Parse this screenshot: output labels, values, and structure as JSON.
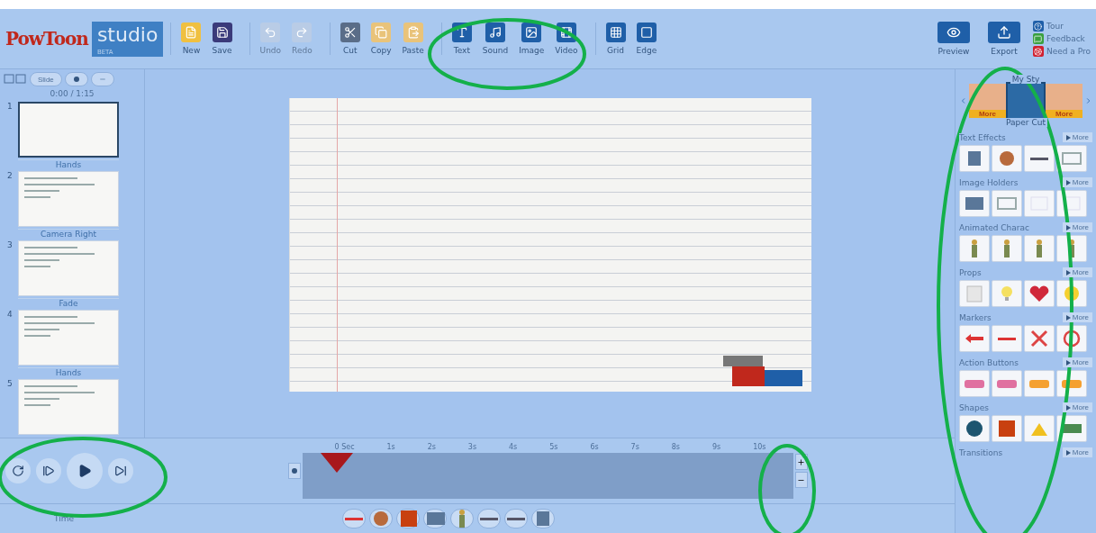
{
  "logo": {
    "brand": "PowToon",
    "product": "studio",
    "tag": "BETA"
  },
  "toolbar": {
    "groups": [
      [
        {
          "kind": "new",
          "label": "New",
          "disabled": false
        },
        {
          "kind": "save",
          "label": "Save",
          "disabled": false
        }
      ],
      [
        {
          "kind": "undo",
          "label": "Undo",
          "disabled": true
        },
        {
          "kind": "redo",
          "label": "Redo",
          "disabled": true
        }
      ],
      [
        {
          "kind": "cut",
          "label": "Cut",
          "disabled": false
        },
        {
          "kind": "copy",
          "label": "Copy",
          "disabled": false
        },
        {
          "kind": "paste",
          "label": "Paste",
          "disabled": false
        }
      ],
      [
        {
          "kind": "text",
          "label": "Text",
          "disabled": false
        },
        {
          "kind": "sound",
          "label": "Sound",
          "disabled": false
        },
        {
          "kind": "image",
          "label": "Image",
          "disabled": false
        },
        {
          "kind": "video",
          "label": "Video",
          "disabled": false
        }
      ],
      [
        {
          "kind": "grid",
          "label": "Grid",
          "disabled": false
        },
        {
          "kind": "edge",
          "label": "Edge",
          "disabled": false
        }
      ]
    ]
  },
  "actions": [
    {
      "kind": "preview",
      "label": "Preview"
    },
    {
      "kind": "export",
      "label": "Export"
    }
  ],
  "help_links": [
    {
      "kind": "tour",
      "label": "Tour"
    },
    {
      "kind": "feedback",
      "label": "Feedback"
    },
    {
      "kind": "pro",
      "label": "Need a Pro"
    }
  ],
  "slides_panel": {
    "view_button": "Slide",
    "counter": "0:00 / 1:15",
    "slides": [
      {
        "number": "1",
        "selected": true,
        "transition": "Hands"
      },
      {
        "number": "2",
        "selected": false,
        "transition": "Camera Right"
      },
      {
        "number": "3",
        "selected": false,
        "transition": "Fade"
      },
      {
        "number": "4",
        "selected": false,
        "transition": "Hands"
      },
      {
        "number": "5",
        "selected": false
      }
    ]
  },
  "timeline": {
    "ticks": [
      "0 Sec",
      "1s",
      "2s",
      "3s",
      "4s",
      "5s",
      "6s",
      "7s",
      "8s",
      "9s",
      "10s"
    ]
  },
  "bottom_labels": [
    "Time"
  ],
  "styles_panel": {
    "title": "My Sty",
    "styles": [
      {
        "selected": false,
        "badge": "More"
      },
      {
        "selected": true
      },
      {
        "selected": false,
        "badge": "More"
      }
    ],
    "style_name": "Paper Cut",
    "sections": [
      {
        "title": "Text Effects",
        "more": "More",
        "items": [
          {
            "kind": "text-t"
          },
          {
            "kind": "hand"
          },
          {
            "kind": "dash"
          },
          {
            "kind": "frame"
          }
        ]
      },
      {
        "title": "Image Holders",
        "more": "More",
        "items": [
          {
            "kind": "photo"
          },
          {
            "kind": "frame"
          },
          {
            "kind": "blank"
          },
          {
            "kind": "blank"
          }
        ]
      },
      {
        "title": "Animated Charac",
        "more": "More",
        "items": [
          {
            "kind": "figure"
          },
          {
            "kind": "figure"
          },
          {
            "kind": "figure"
          },
          {
            "kind": "figure"
          }
        ]
      },
      {
        "title": "Props",
        "more": "More",
        "items": [
          {
            "kind": "paper"
          },
          {
            "kind": "bulb"
          },
          {
            "kind": "heart"
          },
          {
            "kind": "flower"
          }
        ]
      },
      {
        "title": "Markers",
        "more": "More",
        "items": [
          {
            "kind": "arrow"
          },
          {
            "kind": "line"
          },
          {
            "kind": "cross"
          },
          {
            "kind": "ring"
          }
        ]
      },
      {
        "title": "Action Buttons",
        "more": "More",
        "items": [
          {
            "kind": "pill-pink"
          },
          {
            "kind": "pill-pink"
          },
          {
            "kind": "pill-orange"
          },
          {
            "kind": "pill-orange"
          }
        ]
      },
      {
        "title": "Shapes",
        "more": "More",
        "items": [
          {
            "kind": "circle"
          },
          {
            "kind": "square"
          },
          {
            "kind": "triangle"
          },
          {
            "kind": "rect"
          }
        ]
      },
      {
        "title": "Transitions",
        "more": "More"
      }
    ]
  }
}
